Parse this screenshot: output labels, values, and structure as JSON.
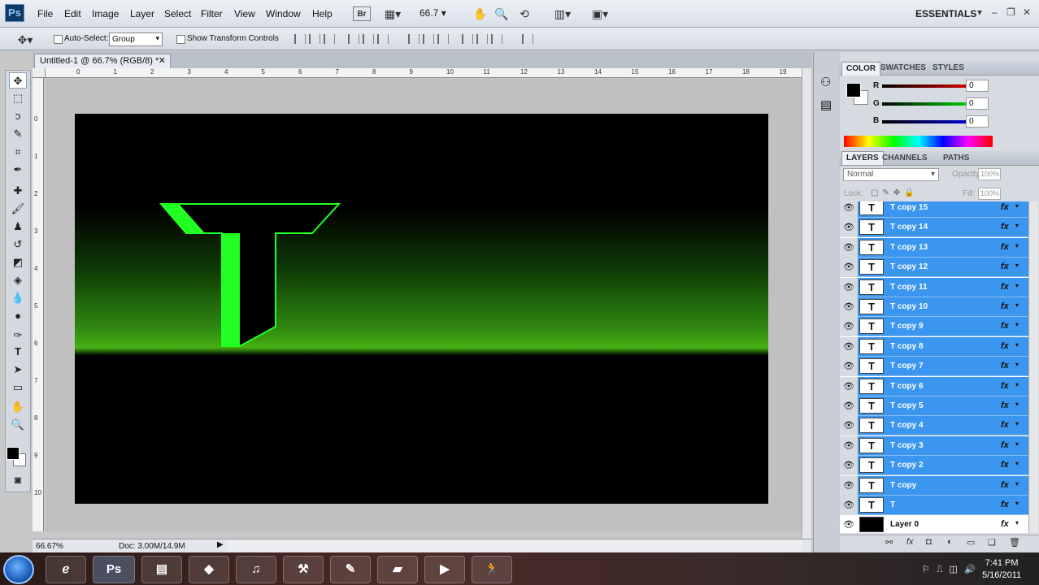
{
  "app": {
    "logo": "Ps"
  },
  "menu": [
    "File",
    "Edit",
    "Image",
    "Layer",
    "Select",
    "Filter",
    "View",
    "Window",
    "Help"
  ],
  "menubar": {
    "br_label": "Br",
    "zoom": "66.7",
    "workspace": "ESSENTIALS"
  },
  "options": {
    "auto_select_label": "Auto-Select:",
    "auto_select_value": "Group",
    "transform_label": "Show Transform Controls"
  },
  "document": {
    "tab_title": "Untitled-1 @ 66.7% (RGB/8) *",
    "close": "✕"
  },
  "rulers": {
    "h": [
      "0",
      "1",
      "2",
      "3",
      "4",
      "5",
      "6",
      "7",
      "8",
      "9",
      "10",
      "11",
      "12",
      "13",
      "14",
      "15",
      "16",
      "17",
      "18",
      "19"
    ],
    "v": [
      "0",
      "1",
      "2",
      "3",
      "4",
      "5",
      "6",
      "7",
      "8",
      "9",
      "10"
    ]
  },
  "status": {
    "zoom": "66.67%",
    "doc": "Doc: 3.00M/14.9M"
  },
  "color_panel": {
    "tabs": [
      "COLOR",
      "SWATCHES",
      "STYLES"
    ],
    "r_label": "R",
    "r_value": "0",
    "g_label": "G",
    "g_value": "0",
    "b_label": "B",
    "b_value": "0"
  },
  "layers_panel": {
    "tabs": [
      "LAYERS",
      "CHANNELS",
      "PATHS"
    ],
    "blend_mode": "Normal",
    "opacity_label": "Opacity:",
    "opacity_value": "100%",
    "lock_label": "Lock:",
    "fill_label": "Fill:",
    "fill_value": "100%"
  },
  "layers": [
    {
      "name": "T copy 15",
      "type": "T",
      "selected": true
    },
    {
      "name": "T copy 14",
      "type": "T",
      "selected": true
    },
    {
      "name": "T copy 13",
      "type": "T",
      "selected": true
    },
    {
      "name": "T copy 12",
      "type": "T",
      "selected": true
    },
    {
      "name": "T copy 11",
      "type": "T",
      "selected": true
    },
    {
      "name": "T copy 10",
      "type": "T",
      "selected": true
    },
    {
      "name": "T copy 9",
      "type": "T",
      "selected": true
    },
    {
      "name": "T copy 8",
      "type": "T",
      "selected": true
    },
    {
      "name": "T copy 7",
      "type": "T",
      "selected": true
    },
    {
      "name": "T copy 6",
      "type": "T",
      "selected": true
    },
    {
      "name": "T copy 5",
      "type": "T",
      "selected": true
    },
    {
      "name": "T copy 4",
      "type": "T",
      "selected": true
    },
    {
      "name": "T copy 3",
      "type": "T",
      "selected": true
    },
    {
      "name": "T copy 2",
      "type": "T",
      "selected": true
    },
    {
      "name": "T copy",
      "type": "T",
      "selected": true
    },
    {
      "name": "T",
      "type": "T",
      "selected": true
    },
    {
      "name": "Layer 0",
      "type": "",
      "selected": false
    }
  ],
  "fx_label": "fx",
  "taskbar": {
    "time": "7:41 PM",
    "date": "5/16/2011",
    "ps_label": "Ps"
  },
  "colors": {
    "selection": "#3a96ee",
    "neon": "#22ff22"
  }
}
